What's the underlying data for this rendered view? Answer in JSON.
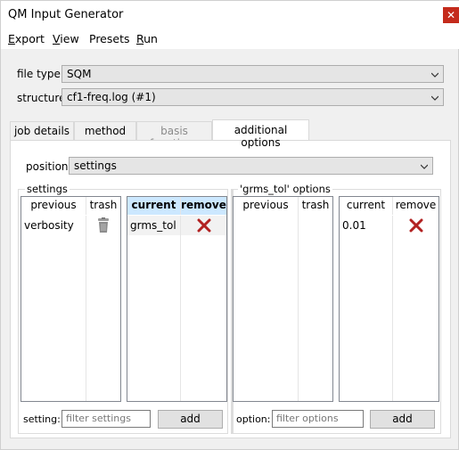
{
  "window": {
    "title": "QM Input Generator",
    "close_glyph": "✕"
  },
  "menu": [
    {
      "label": "Export",
      "mnemonic": "E",
      "rest": "xport"
    },
    {
      "label": "View",
      "mnemonic": "V",
      "rest": "iew"
    },
    {
      "label": "Presets",
      "mnemonic": "",
      "rest": "Presets"
    },
    {
      "label": "Run",
      "mnemonic": "R",
      "rest": "un"
    }
  ],
  "form": {
    "file_type_label": "file type:",
    "file_type_value": "SQM",
    "structure_label": "structure:",
    "structure_value": "cf1-freq.log (#1)"
  },
  "tabs": [
    {
      "label": "job details",
      "state": "normal"
    },
    {
      "label": "method",
      "state": "normal"
    },
    {
      "label": "basis functions",
      "state": "disabled"
    },
    {
      "label": "additional options",
      "state": "active"
    }
  ],
  "panel": {
    "position_label": "position:",
    "position_value": "settings",
    "settings_group": {
      "title": "settings",
      "previous": {
        "columns": [
          "previous",
          "trash"
        ],
        "rows": [
          {
            "name": "verbosity",
            "icon": "trash-icon"
          }
        ]
      },
      "current": {
        "columns": [
          "current",
          "remove"
        ],
        "rows": [
          {
            "name": "grms_tol",
            "icon": "remove-x-icon"
          }
        ]
      },
      "filter_label": "setting:",
      "filter_placeholder": "filter settings",
      "add_label": "add"
    },
    "options_group": {
      "title": "'grms_tol' options",
      "previous": {
        "columns": [
          "previous",
          "trash"
        ],
        "rows": []
      },
      "current": {
        "columns": [
          "current",
          "remove"
        ],
        "rows": [
          {
            "name": "0.01",
            "icon": "remove-x-icon"
          }
        ]
      },
      "filter_label": "option:",
      "filter_placeholder": "filter options",
      "add_label": "add"
    }
  },
  "colors": {
    "close_red": "#c42b1c",
    "header_selected": "#cce8ff",
    "remove_x": "#b22222",
    "trash_gray": "#8c8c8c"
  }
}
